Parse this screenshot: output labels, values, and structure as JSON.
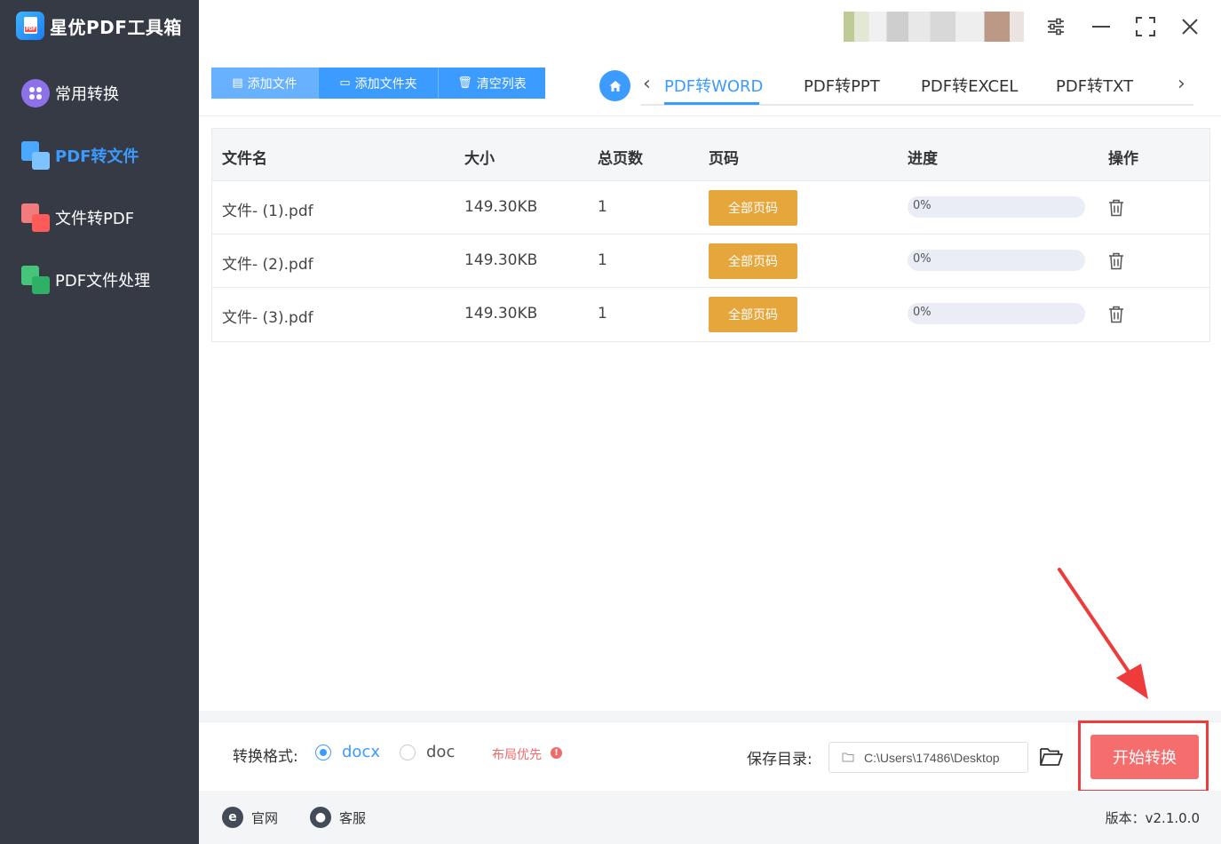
{
  "app": {
    "title": "星优PDF工具箱"
  },
  "sidebar": {
    "items": [
      {
        "label": "常用转换",
        "icon": "apps-icon",
        "active": false
      },
      {
        "label": "PDF转文件",
        "icon": "pdf-to-file-icon",
        "active": true
      },
      {
        "label": "文件转PDF",
        "icon": "file-to-pdf-icon",
        "active": false
      },
      {
        "label": "PDF文件处理",
        "icon": "pdf-process-icon",
        "active": false
      }
    ]
  },
  "toolbar": {
    "add_file": "添加文件",
    "add_folder": "添加文件夹",
    "clear_list": "清空列表"
  },
  "tabs": {
    "items": [
      "PDF转WORD",
      "PDF转PPT",
      "PDF转EXCEL",
      "PDF转TXT"
    ],
    "active_index": 0
  },
  "table": {
    "headers": [
      "文件名",
      "大小",
      "总页数",
      "页码",
      "进度",
      "操作"
    ],
    "rows": [
      {
        "name": "文件- (1).pdf",
        "size": "149.30KB",
        "pages": "1",
        "page_btn": "全部页码",
        "progress": 0,
        "progress_text": "0%"
      },
      {
        "name": "文件- (2).pdf",
        "size": "149.30KB",
        "pages": "1",
        "page_btn": "全部页码",
        "progress": 0,
        "progress_text": "0%"
      },
      {
        "name": "文件- (3).pdf",
        "size": "149.30KB",
        "pages": "1",
        "page_btn": "全部页码",
        "progress": 0,
        "progress_text": "0%"
      }
    ]
  },
  "options": {
    "format_label": "转换格式:",
    "formats": [
      {
        "label": "docx",
        "checked": true
      },
      {
        "label": "doc",
        "checked": false
      }
    ],
    "layout_first": "布局优先",
    "save_label": "保存目录:",
    "save_path": "C:\\Users\\17486\\Desktop",
    "start_button": "开始转换"
  },
  "footer": {
    "website": "官网",
    "support": "客服",
    "version": "版本：v2.1.0.0"
  },
  "colors": {
    "sidebar_bg": "#363a45",
    "accent": "#3c9bff",
    "page_btn": "#e5a63c",
    "start_btn": "#f56d6d",
    "highlight_frame": "#ee3b3b"
  }
}
